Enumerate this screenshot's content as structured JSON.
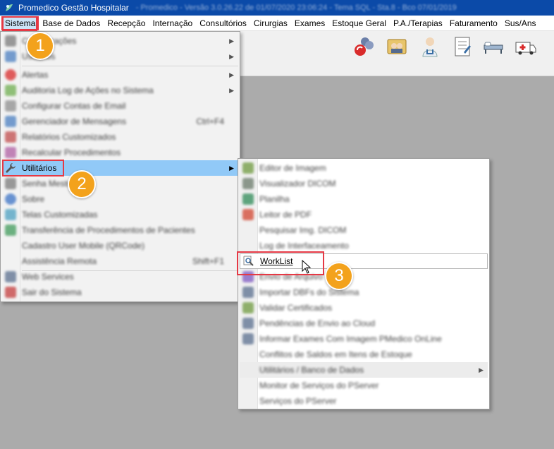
{
  "window": {
    "title": "Promedico Gestão Hospitalar",
    "title_extra": "- Promedico - Versão 3.0.26.22 de 01/07/2020 23:06:24 - Tema SQL - Sta.8 - Bco 07/01/2019"
  },
  "menubar": {
    "items": [
      "Sistema",
      "Base de Dados",
      "Recepção",
      "Internação",
      "Consultórios",
      "Cirurgias",
      "Exames",
      "Estoque Geral",
      "P.A./Terapias",
      "Faturamento",
      "Sus/Ans"
    ]
  },
  "toolbar": {
    "icons": [
      "users-sync-icon",
      "group-photo-icon",
      "doctor-icon",
      "checklist-icon",
      "hospital-bed-icon",
      "ambulance-icon"
    ]
  },
  "sistema_menu": {
    "items": [
      {
        "label": "Configurações",
        "shortcut": "",
        "submenu": true
      },
      {
        "label": "Usuários",
        "shortcut": "",
        "submenu": true
      },
      {
        "label": "Alertas",
        "shortcut": "",
        "submenu": true
      },
      {
        "label": "Auditoria Log de Ações no Sistema",
        "shortcut": "",
        "submenu": true
      },
      {
        "label": "Configurar Contas de Email",
        "shortcut": "",
        "submenu": false
      },
      {
        "label": "Gerenciador de Mensagens",
        "shortcut": "Ctrl+F4",
        "submenu": false
      },
      {
        "label": "Relatórios Customizados",
        "shortcut": "",
        "submenu": false
      },
      {
        "label": "Recalcular Procedimentos",
        "shortcut": "",
        "submenu": false
      },
      {
        "label": "Utilitários",
        "shortcut": "",
        "submenu": true
      },
      {
        "label": "Senha Mestre",
        "shortcut": "",
        "submenu": false
      },
      {
        "label": "Sobre",
        "shortcut": "",
        "submenu": false
      },
      {
        "label": "Telas Customizadas",
        "shortcut": "",
        "submenu": false
      },
      {
        "label": "Transferência de Procedimentos de Pacientes",
        "shortcut": "",
        "submenu": false
      },
      {
        "label": "Cadastro User Mobile (QRCode)",
        "shortcut": "",
        "submenu": false
      },
      {
        "label": "Assistência Remota",
        "shortcut": "Shift+F1",
        "submenu": false
      },
      {
        "label": "Web Services",
        "shortcut": "",
        "submenu": false
      },
      {
        "label": "Sair do Sistema",
        "shortcut": "",
        "submenu": false
      }
    ]
  },
  "utilitarios_menu": {
    "items": [
      {
        "label": "Editor de Imagem",
        "submenu": false
      },
      {
        "label": "Visualizador DICOM",
        "submenu": false
      },
      {
        "label": "Planilha",
        "submenu": false
      },
      {
        "label": "Leitor de PDF",
        "submenu": false
      },
      {
        "label": "Pesquisar Img. DICOM",
        "submenu": false
      },
      {
        "label": "Log de Interfaceamento",
        "submenu": false
      },
      {
        "label": "WorkList",
        "submenu": false
      },
      {
        "label": "Envio de Arquivo",
        "submenu": false
      },
      {
        "label": "Importar DBFs do Sistema",
        "submenu": false
      },
      {
        "label": "Validar Certificados",
        "submenu": false
      },
      {
        "label": "Pendências de Envio ao Cloud",
        "submenu": false
      },
      {
        "label": "Informar Exames Com Imagem PMedico OnLine",
        "submenu": false
      },
      {
        "label": "Conflitos de Saldos em Itens de Estoque",
        "submenu": false
      },
      {
        "label": "Utilitários / Banco de Dados",
        "submenu": true
      },
      {
        "label": "Monitor de Serviços do PServer",
        "submenu": false
      },
      {
        "label": "Serviços do PServer",
        "submenu": false
      }
    ]
  },
  "badges": [
    "1",
    "2",
    "3"
  ],
  "colors": {
    "titlebar": "#0b4aa8",
    "highlight": "#91c9f7",
    "annotation_red": "#e53945",
    "badge_orange": "#f3a21c"
  }
}
